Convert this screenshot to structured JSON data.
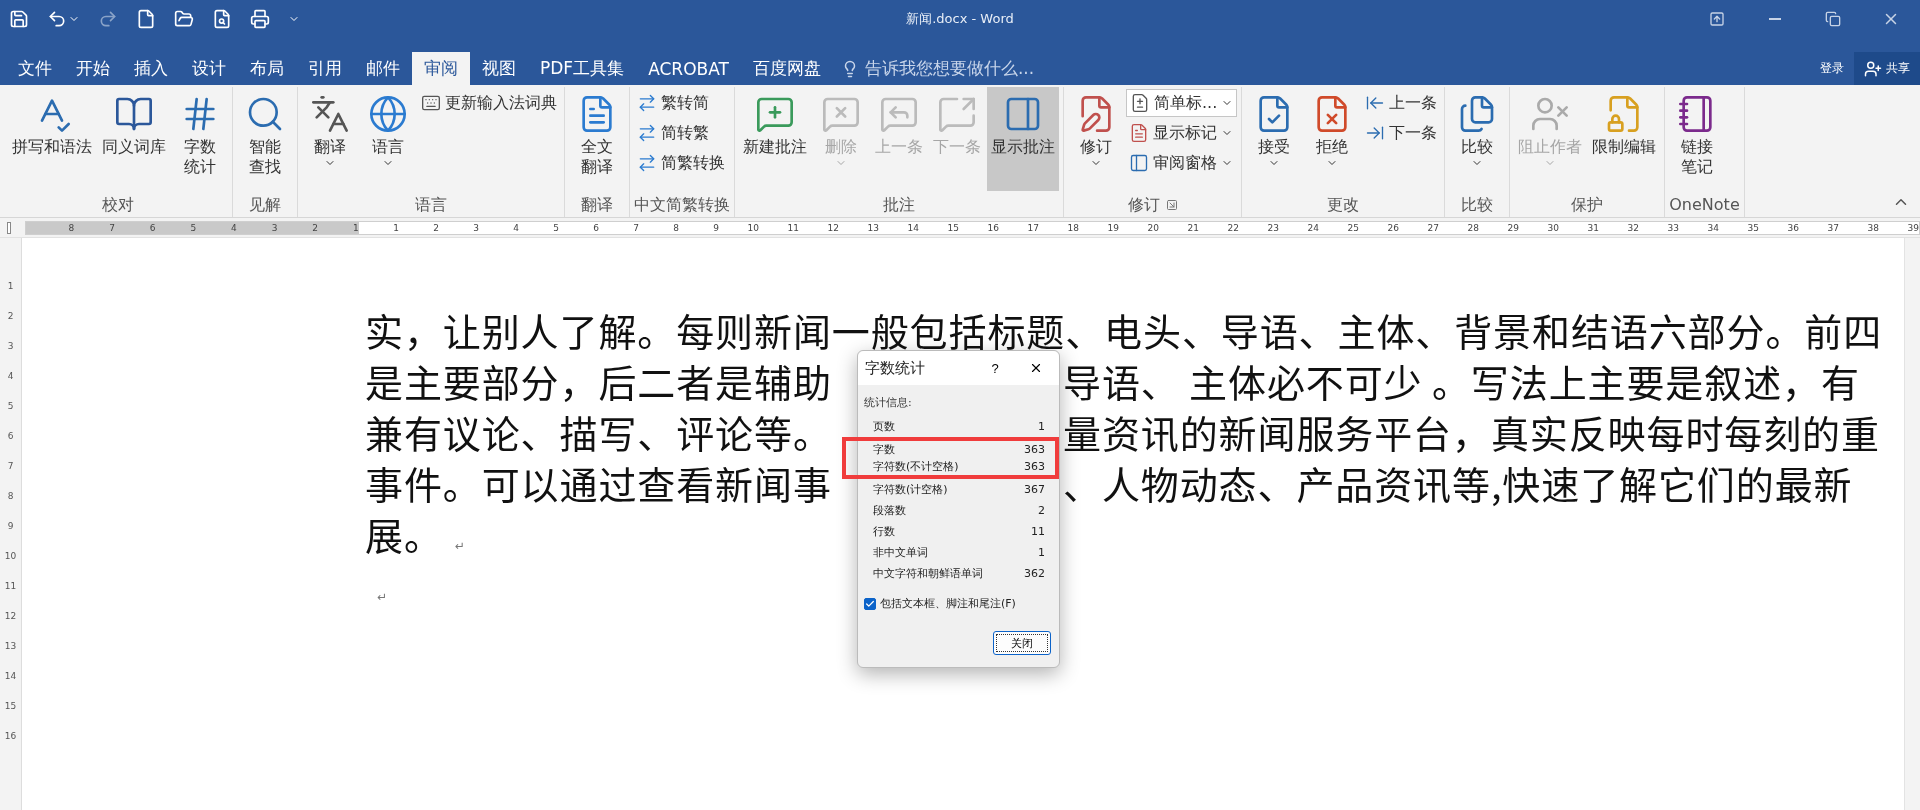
{
  "window": {
    "title": "新闻.docx - Word"
  },
  "quick_access": [
    {
      "disabled": false
    },
    {
      "disabled": false
    },
    {
      "disabled": true
    },
    {
      "disabled": false
    },
    {
      "disabled": false
    },
    {
      "disabled": false
    },
    {
      "disabled": false
    },
    {
      "disabled": false
    }
  ],
  "tabs": [
    {
      "label": "文件",
      "selected": false
    },
    {
      "label": "开始",
      "selected": false
    },
    {
      "label": "插入",
      "selected": false
    },
    {
      "label": "设计",
      "selected": false
    },
    {
      "label": "布局",
      "selected": false
    },
    {
      "label": "引用",
      "selected": false
    },
    {
      "label": "邮件",
      "selected": false
    },
    {
      "label": "审阅",
      "selected": true
    },
    {
      "label": "视图",
      "selected": false
    },
    {
      "label": "PDF工具集",
      "selected": false
    },
    {
      "label": "ACROBAT",
      "selected": false
    },
    {
      "label": "百度网盘",
      "selected": false
    }
  ],
  "tell_me": {
    "placeholder": "告诉我您想要做什么..."
  },
  "sign_in": "登录",
  "share": "共享",
  "ribbon_groups": [
    {
      "label": "校对",
      "items": [
        {
          "kind": "large",
          "lines": [
            "拼写和语法"
          ],
          "disabled": false,
          "selected": false,
          "caret": false
        },
        {
          "kind": "large",
          "lines": [
            "同义词库"
          ],
          "disabled": false,
          "selected": false,
          "caret": false
        },
        {
          "kind": "large",
          "lines": [
            "字数",
            "统计"
          ],
          "disabled": false,
          "selected": false,
          "caret": false
        }
      ]
    },
    {
      "label": "见解",
      "items": [
        {
          "kind": "large",
          "lines": [
            "智能",
            "查找"
          ],
          "disabled": false,
          "selected": false,
          "caret": false
        }
      ]
    },
    {
      "label": "语言",
      "items": [
        {
          "kind": "large",
          "lines": [
            "翻译"
          ],
          "disabled": false,
          "selected": false,
          "caret": true
        },
        {
          "kind": "large",
          "lines": [
            "语言"
          ],
          "disabled": false,
          "selected": false,
          "caret": true
        },
        {
          "kind": "stack",
          "items": [
            {
              "label": "更新输入法词典",
              "disabled": false,
              "caret": false
            }
          ]
        }
      ]
    },
    {
      "label": "翻译",
      "items": [
        {
          "kind": "large",
          "lines": [
            "全文",
            "翻译"
          ],
          "disabled": false,
          "selected": false,
          "caret": false
        }
      ]
    },
    {
      "label": "中文简繁转换",
      "items": [
        {
          "kind": "stack",
          "items": [
            {
              "label": "繁转简",
              "disabled": false,
              "caret": false
            },
            {
              "label": "简转繁",
              "disabled": false,
              "caret": false
            },
            {
              "label": "简繁转换",
              "disabled": false,
              "caret": false
            }
          ]
        }
      ]
    },
    {
      "label": "批注",
      "items": [
        {
          "kind": "large",
          "lines": [
            "新建批注"
          ],
          "disabled": false,
          "selected": false,
          "caret": false
        },
        {
          "kind": "large",
          "lines": [
            "删除"
          ],
          "disabled": true,
          "selected": false,
          "caret": true
        },
        {
          "kind": "large",
          "lines": [
            "上一条"
          ],
          "disabled": true,
          "selected": false,
          "caret": false
        },
        {
          "kind": "large",
          "lines": [
            "下一条"
          ],
          "disabled": true,
          "selected": false,
          "caret": false
        },
        {
          "kind": "large",
          "lines": [
            "显示批注"
          ],
          "disabled": false,
          "selected": true,
          "caret": false
        }
      ]
    },
    {
      "label": "修订",
      "items": [
        {
          "kind": "large",
          "lines": [
            "修订"
          ],
          "disabled": false,
          "selected": false,
          "caret": true
        },
        {
          "kind": "stack",
          "items": [
            {
              "label": "简单标...",
              "disabled": false,
              "caret": true
            },
            {
              "label": "显示标记",
              "disabled": false,
              "caret": true
            },
            {
              "label": "审阅窗格",
              "disabled": false,
              "caret": true
            }
          ]
        }
      ]
    },
    {
      "label": "更改",
      "items": [
        {
          "kind": "large",
          "lines": [
            "接受"
          ],
          "disabled": false,
          "selected": false,
          "caret": true
        },
        {
          "kind": "large",
          "lines": [
            "拒绝"
          ],
          "disabled": false,
          "selected": false,
          "caret": true
        },
        {
          "kind": "stack",
          "items": [
            {
              "label": "上一条",
              "disabled": false,
              "caret": false
            },
            {
              "label": "下一条",
              "disabled": false,
              "caret": false
            }
          ]
        }
      ]
    },
    {
      "label": "比较",
      "items": [
        {
          "kind": "large",
          "lines": [
            "比较"
          ],
          "disabled": false,
          "selected": false,
          "caret": true
        }
      ]
    },
    {
      "label": "保护",
      "items": [
        {
          "kind": "large",
          "lines": [
            "阻止作者"
          ],
          "disabled": true,
          "selected": false,
          "caret": true
        },
        {
          "kind": "large",
          "lines": [
            "限制编辑"
          ],
          "disabled": false,
          "selected": false,
          "caret": false
        }
      ]
    },
    {
      "label": "OneNote",
      "items": [
        {
          "kind": "large",
          "lines": [
            "链接",
            "笔记"
          ],
          "disabled": false,
          "selected": false,
          "caret": false
        }
      ]
    }
  ],
  "ruler": {
    "left_numbers": [
      "8",
      "7",
      "6",
      "5",
      "4",
      "3",
      "2",
      "1"
    ],
    "right_numbers": [
      "1",
      "2",
      "3",
      "4",
      "5",
      "6",
      "7",
      "8",
      "9",
      "10",
      "11",
      "12",
      "13",
      "14",
      "15",
      "16",
      "17",
      "18",
      "19",
      "20",
      "21",
      "22",
      "23",
      "24",
      "25",
      "26",
      "27",
      "28",
      "29",
      "30",
      "31",
      "32",
      "33",
      "34",
      "35",
      "36",
      "37",
      "38",
      "39"
    ],
    "vertical_numbers": [
      "1",
      "2",
      "3",
      "4",
      "5",
      "6",
      "7",
      "8",
      "9",
      "10",
      "11",
      "12",
      "13",
      "14",
      "15",
      "16"
    ]
  },
  "document": {
    "lines": [
      {
        "left": "实，让别人了解。每则新闻一般包括标题、电头、导语、主体、背景和结语六部分。前四"
      },
      {
        "left": "是主要部分，后二者是辅助",
        "right": "导语、 主体必不可少 。写法上主要是叙述，有"
      },
      {
        "left": "兼有议论、描写、评论等。",
        "right": "量资讯的新闻服务平台，真实反映每时每刻的重"
      },
      {
        "left": "事件。可以通过查看新闻事",
        "right": "、人物动态、产品资讯等,快速了解它们的最新"
      },
      {
        "left": "展。",
        "mark": "↵"
      },
      {
        "mark": "↵"
      }
    ]
  },
  "dialog": {
    "title": "字数统计",
    "help": "?",
    "section": "统计信息:",
    "stats": [
      {
        "label": "页数",
        "value": "1",
        "highlighted": false
      },
      {
        "label": "字数",
        "value": "363",
        "highlighted": true
      },
      {
        "label": "字符数(不计空格)",
        "value": "363",
        "highlighted": true
      },
      {
        "label": "字符数(计空格)",
        "value": "367",
        "highlighted": false
      },
      {
        "label": "段落数",
        "value": "2",
        "highlighted": false
      },
      {
        "label": "行数",
        "value": "11",
        "highlighted": false
      },
      {
        "label": "非中文单词",
        "value": "1",
        "highlighted": false
      },
      {
        "label": "中文字符和朝鲜语单词",
        "value": "362",
        "highlighted": false
      }
    ],
    "checkbox": {
      "label": "包括文本框、脚注和尾注(F)",
      "checked": true
    },
    "button": "关闭"
  }
}
